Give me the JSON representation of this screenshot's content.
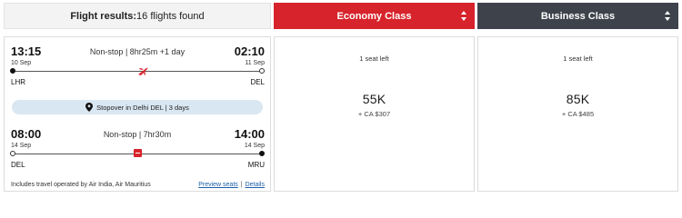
{
  "header": {
    "results_label": "Flight results:",
    "results_count": "16 flights found",
    "economy_label": "Economy Class",
    "business_label": "Business Class"
  },
  "segments": [
    {
      "dep_time": "13:15",
      "arr_time": "02:10",
      "summary": "Non-stop | 8hr25m +1 day",
      "dep_date": "10 Sep",
      "arr_date": "11 Sep",
      "dep_code": "LHR",
      "arr_code": "DEL",
      "marker_icon": "airplane-icon"
    },
    {
      "dep_time": "08:00",
      "arr_time": "14:00",
      "summary": "Non-stop | 7hr30m",
      "dep_date": "14 Sep",
      "arr_date": "14 Sep",
      "dep_code": "DEL",
      "arr_code": "MRU",
      "marker_icon": "airline-badge-icon"
    }
  ],
  "stopover": {
    "icon": "location-pin-icon",
    "text": "Stopover in Delhi DEL | 3 days"
  },
  "footer": {
    "operated_by": "Includes travel operated by Air India, Air Mauritius",
    "preview_seats": "Preview seats",
    "separator": "|",
    "details": "Details"
  },
  "fares": {
    "economy": {
      "seats": "1 seat left",
      "points": "55K",
      "cash": "+ CA $307"
    },
    "business": {
      "seats": "1 seat left",
      "points": "85K",
      "cash": "+ CA $485"
    }
  },
  "colors": {
    "economy_header": "#d7232b",
    "business_header": "#3e434b",
    "stopover_bg": "#d9e7f2",
    "link": "#1d5fa8"
  }
}
